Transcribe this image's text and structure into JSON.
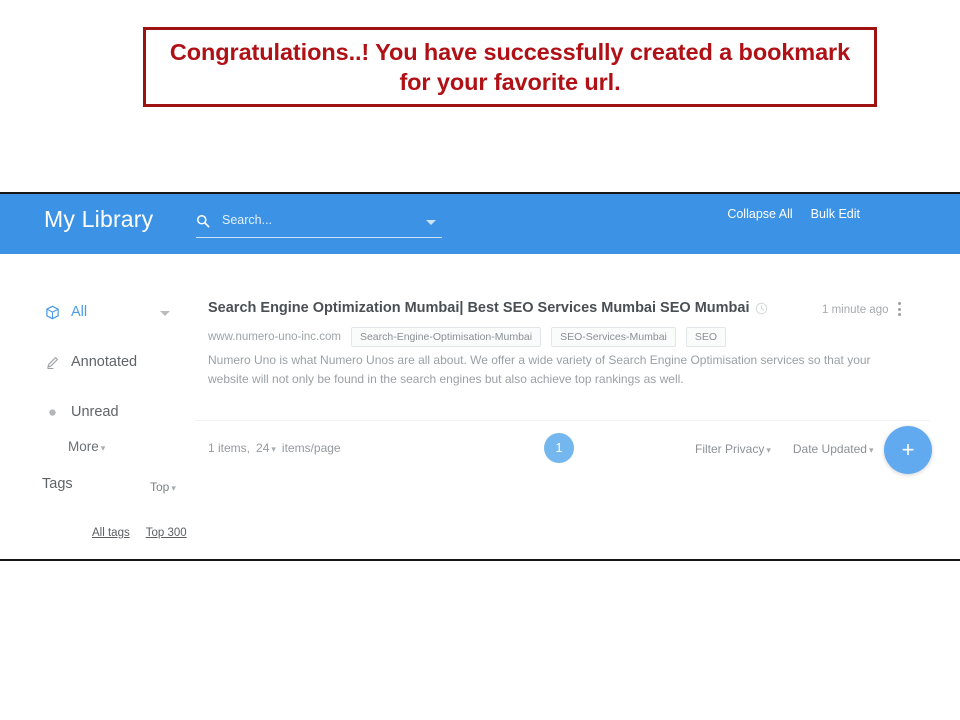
{
  "banner": {
    "text": "Congratulations..! You have successfully created a bookmark for your favorite url.",
    "border_color": "#9e1212",
    "text_color": "#b01116"
  },
  "app": {
    "title": "My Library",
    "header_color": "#3c92e5",
    "search": {
      "placeholder": "Search...",
      "value": "",
      "icon": "search-icon",
      "caret_icon": "chevron-down-icon"
    },
    "header_links": [
      {
        "label": "Collapse All"
      },
      {
        "label": "Bulk Edit"
      }
    ],
    "fab": {
      "label": "+",
      "icon": "plus-icon",
      "color": "#62aaf0"
    }
  },
  "sidebar": {
    "items": [
      {
        "label": "All",
        "icon": "box-icon",
        "active": true
      },
      {
        "label": "Annotated",
        "icon": "pencil-icon",
        "active": false
      },
      {
        "label": "Unread",
        "icon": "dot-icon",
        "active": false
      }
    ],
    "more_label": "More",
    "tags_label": "Tags",
    "tags_sort_label": "Top",
    "tag_links": [
      {
        "label": "All tags"
      },
      {
        "label": "Top 300"
      }
    ]
  },
  "bookmark": {
    "title": "Search Engine Optimization Mumbai| Best SEO Services Mumbai SEO Mumbai",
    "title_icon": "clock-icon",
    "domain": "www.numero-uno-inc.com",
    "tags": [
      "Search-Engine-Optimisation-Mumbai",
      "SEO-Services-Mumbai",
      "SEO"
    ],
    "description": "Numero Uno is what Numero Unos are all about. We offer a wide variety of Search Engine Optimisation services so that your website will not only be found in the search engines but also achieve top rankings as well.",
    "timestamp": "1 minute ago",
    "menu_icon": "kebab-menu-icon"
  },
  "footer": {
    "items_count": "1 items,",
    "per_page": "24",
    "per_page_suffix": "items/page",
    "current_page": "1",
    "filter_privacy": "Filter Privacy",
    "date_updated": "Date Updated",
    "rss_icon": "rss-icon",
    "rss_color": "#f0900a"
  }
}
